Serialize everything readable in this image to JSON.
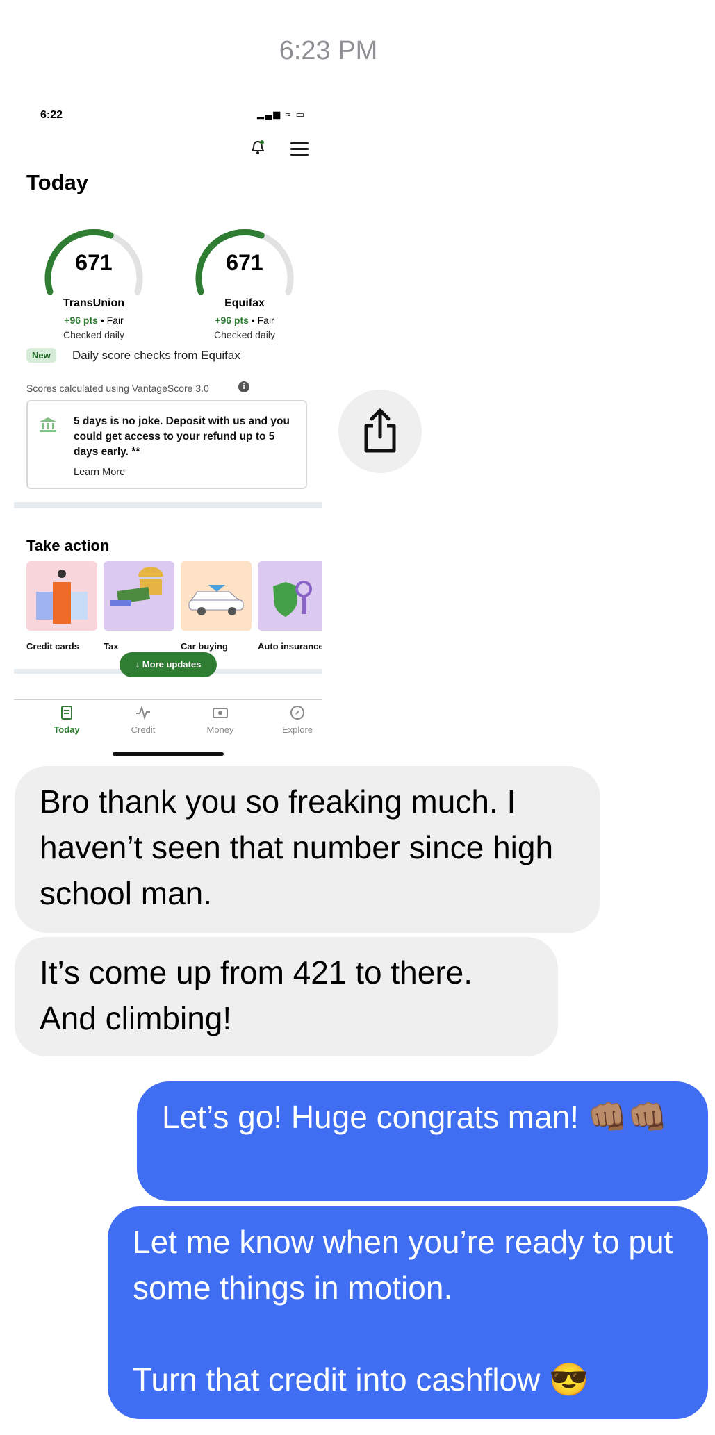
{
  "message_timestamp": "6:23 PM",
  "screenshot": {
    "status_time": "6:22",
    "status_icons": "▂▄▆ ≈ ▭",
    "page_title": "Today",
    "scores": [
      {
        "score": "671",
        "bureau": "TransUnion",
        "pts": "+96 pts",
        "rating": "• Fair",
        "checked": "Checked daily",
        "fill": 0.6
      },
      {
        "score": "671",
        "bureau": "Equifax",
        "pts": "+96 pts",
        "rating": "• Fair",
        "checked": "Checked daily",
        "fill": 0.6
      }
    ],
    "new_badge": "New",
    "new_text": "Daily score checks from Equifax",
    "vantage_note": "Scores calculated using VantageScore 3.0",
    "info_glyph": "i",
    "promo_text": "5 days is no joke. Deposit with us and you could get access to your refund up to 5 days early. **",
    "promo_link": "Learn More",
    "take_action_title": "Take action",
    "action_cards": [
      {
        "label": "Credit cards",
        "color": "#f9d5dc"
      },
      {
        "label": "Tax",
        "color": "#dcc9ef"
      },
      {
        "label": "Car buying",
        "color": "#fde2c7"
      },
      {
        "label": "Auto insurance",
        "color": "#dcc9ef"
      }
    ],
    "more_updates": "↓ More updates",
    "tabs": [
      {
        "label": "Today",
        "icon": "document-icon",
        "active": true
      },
      {
        "label": "Credit",
        "icon": "pulse-icon",
        "active": false
      },
      {
        "label": "Money",
        "icon": "cash-icon",
        "active": false
      },
      {
        "label": "Explore",
        "icon": "compass-icon",
        "active": false
      }
    ]
  },
  "messages": [
    {
      "direction": "incoming",
      "text": "Bro thank you so freaking much. I haven’t seen that number since high school man."
    },
    {
      "direction": "incoming",
      "text": "It’s come up from 421 to there. And climbing!"
    },
    {
      "direction": "outgoing",
      "text": "Let’s go! Huge congrats man! 👊🏽👊🏽"
    },
    {
      "direction": "outgoing",
      "text": "Let me know when you’re ready to put some things in motion.\n\nTurn that credit into cashflow 😎"
    }
  ],
  "colors": {
    "outgoing_bubble": "#3f6ef2",
    "incoming_bubble": "#efefef",
    "accent_green": "#2e7d32"
  }
}
